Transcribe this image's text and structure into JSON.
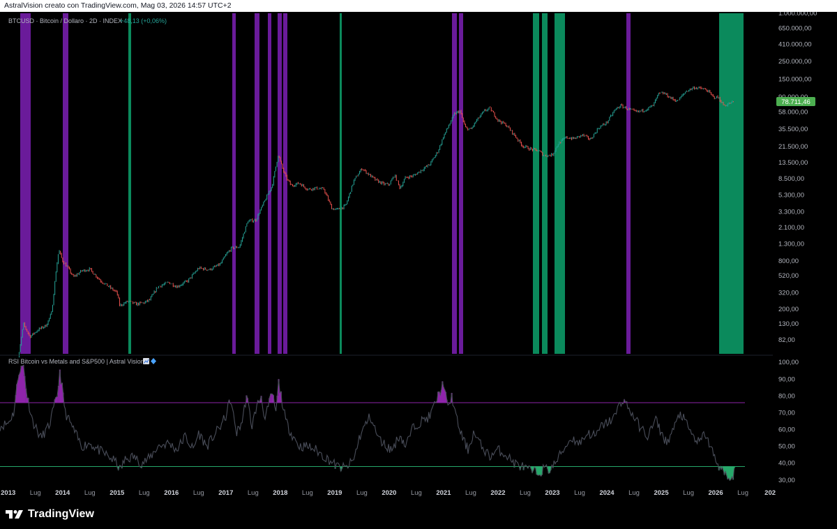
{
  "header": {
    "caption": "AstralVision creato con TradingView.com, Mag 03, 2026 14:57 UTC+2"
  },
  "price_pane": {
    "legend_symbol": "BTCUSD · Bitcoin / Dollaro · 2D · INDEX",
    "legend_change": "+48,13 (+0,06%)",
    "change_color": "#26a69a",
    "last_price_label": "78.711,46",
    "last_price_color": "#4caf50"
  },
  "indicator_pane": {
    "title": "RSI Bitcoin vs Metals and S&P500 | Astral Vision",
    "icons": [
      "chart-emoji-icon",
      "diamond-icon"
    ]
  },
  "footer": {
    "brand": "TradingView"
  },
  "colors": {
    "purple_band": "#6a1b9a",
    "green_band": "#0b8a5c",
    "rsi_line": "#4a4e5a",
    "upper_level": "#8e24aa",
    "lower_level": "#26a86a",
    "candle_up": "#26a69a",
    "candle_down": "#ef5350"
  },
  "chart_data": [
    {
      "type": "line",
      "name_in_legend": "BTCUSD · Bitcoin / Dollaro · 2D · INDEX",
      "scale": "log",
      "y_tick_labels": [
        "1.000.000,00",
        "650.000,00",
        "410.000,00",
        "250.000,00",
        "150.000,00",
        "90.000,00",
        "58.000,00",
        "35.500,00",
        "21.500,00",
        "13.500,00",
        "8.500,00",
        "5.300,00",
        "3.300,00",
        "2.100,00",
        "1.300,00",
        "800,00",
        "520,00",
        "320,00",
        "200,00",
        "130,00",
        "82,00"
      ],
      "y_tick_values": [
        1000000,
        650000,
        410000,
        250000,
        150000,
        90000,
        58000,
        35500,
        21500,
        13500,
        8500,
        5300,
        3300,
        2100,
        1300,
        800,
        520,
        320,
        200,
        130,
        82
      ],
      "ylim": [
        55,
        1000000
      ],
      "x_tick_labels": [
        "2013",
        "Lug",
        "2014",
        "Lug",
        "2015",
        "Lug",
        "2016",
        "Lug",
        "2017",
        "Lug",
        "2018",
        "Lug",
        "2019",
        "Lug",
        "2020",
        "Lug",
        "2021",
        "Lug",
        "2022",
        "Lug",
        "2023",
        "Lug",
        "2024",
        "Lug",
        "2025",
        "Lug",
        "2026",
        "Lug",
        "202"
      ],
      "x_tick_values": [
        2013.0,
        2013.5,
        2014.0,
        2014.5,
        2015.0,
        2015.5,
        2016.0,
        2016.5,
        2017.0,
        2017.5,
        2018.0,
        2018.5,
        2019.0,
        2019.5,
        2020.0,
        2020.5,
        2021.0,
        2021.5,
        2022.0,
        2022.5,
        2023.0,
        2023.5,
        2024.0,
        2024.5,
        2025.0,
        2025.5,
        2026.0,
        2026.5,
        2027.0
      ],
      "xlim": [
        2012.85,
        2027.05
      ],
      "x": [
        2013.12,
        2013.2,
        2013.28,
        2013.4,
        2013.55,
        2013.7,
        2013.8,
        2013.88,
        2013.93,
        2014.0,
        2014.1,
        2014.2,
        2014.35,
        2014.5,
        2014.7,
        2014.85,
        2015.0,
        2015.05,
        2015.2,
        2015.35,
        2015.5,
        2015.6,
        2015.75,
        2015.95,
        2016.1,
        2016.3,
        2016.5,
        2016.7,
        2016.9,
        2017.0,
        2017.1,
        2017.25,
        2017.4,
        2017.55,
        2017.7,
        2017.85,
        2017.96,
        2018.05,
        2018.1,
        2018.2,
        2018.35,
        2018.5,
        2018.65,
        2018.8,
        2018.95,
        2019.05,
        2019.2,
        2019.35,
        2019.5,
        2019.6,
        2019.75,
        2019.9,
        2020.0,
        2020.1,
        2020.2,
        2020.3,
        2020.45,
        2020.6,
        2020.75,
        2020.9,
        2021.0,
        2021.1,
        2021.2,
        2021.3,
        2021.4,
        2021.5,
        2021.6,
        2021.75,
        2021.85,
        2022.0,
        2022.15,
        2022.3,
        2022.45,
        2022.6,
        2022.75,
        2022.85,
        2023.0,
        2023.1,
        2023.25,
        2023.4,
        2023.55,
        2023.7,
        2023.85,
        2024.0,
        2024.15,
        2024.25,
        2024.4,
        2024.55,
        2024.7,
        2024.85,
        2024.95,
        2025.05,
        2025.2,
        2025.3,
        2025.45,
        2025.6,
        2025.75,
        2025.85,
        2025.95,
        2026.05,
        2026.15,
        2026.25,
        2026.34
      ],
      "y": [
        20,
        55,
        130,
        90,
        110,
        125,
        180,
        600,
        1100,
        800,
        650,
        500,
        600,
        630,
        450,
        380,
        320,
        220,
        250,
        230,
        240,
        260,
        380,
        430,
        380,
        450,
        650,
        620,
        730,
        950,
        1150,
        1200,
        2500,
        2600,
        4300,
        7000,
        17000,
        11000,
        9000,
        7000,
        7500,
        6300,
        6500,
        6300,
        3600,
        3500,
        3900,
        8000,
        11500,
        10000,
        8200,
        7300,
        7200,
        9500,
        6500,
        8800,
        9300,
        11000,
        13000,
        19000,
        29000,
        40000,
        55000,
        60000,
        37000,
        35000,
        45000,
        60000,
        65000,
        46000,
        40000,
        30000,
        22000,
        20000,
        19000,
        16500,
        17000,
        23000,
        28000,
        27000,
        30000,
        26500,
        37000,
        43000,
        62000,
        70000,
        63000,
        58000,
        62000,
        70000,
        98000,
        100000,
        85000,
        80000,
        105000,
        118000,
        114000,
        108000,
        90000,
        88000,
        70000,
        74000,
        78711.46
      ]
    },
    {
      "type": "area",
      "name_in_legend": "RSI Bitcoin vs Metals and S&P500 | Astral Vision",
      "y_tick_labels": [
        "100,00",
        "90,00",
        "80,00",
        "70,00",
        "60,00",
        "50,00",
        "40,00",
        "30,00"
      ],
      "y_tick_values": [
        100,
        90,
        80,
        70,
        60,
        50,
        40,
        30
      ],
      "ylim": [
        27,
        103
      ],
      "upper_level": 76,
      "lower_level": 38,
      "x": [
        2012.85,
        2013.0,
        2013.1,
        2013.2,
        2013.28,
        2013.35,
        2013.45,
        2013.6,
        2013.75,
        2013.9,
        2013.95,
        2014.05,
        2014.2,
        2014.35,
        2014.5,
        2014.65,
        2014.8,
        2015.0,
        2015.05,
        2015.15,
        2015.3,
        2015.45,
        2015.6,
        2015.75,
        2015.95,
        2016.1,
        2016.25,
        2016.4,
        2016.5,
        2016.65,
        2016.75,
        2016.9,
        2017.0,
        2017.08,
        2017.2,
        2017.3,
        2017.38,
        2017.48,
        2017.55,
        2017.65,
        2017.72,
        2017.8,
        2017.85,
        2017.92,
        2017.97,
        2018.1,
        2018.2,
        2018.35,
        2018.5,
        2018.65,
        2018.8,
        2018.9,
        2018.97,
        2019.05,
        2019.2,
        2019.35,
        2019.45,
        2019.55,
        2019.65,
        2019.8,
        2019.95,
        2020.05,
        2020.2,
        2020.3,
        2020.45,
        2020.6,
        2020.75,
        2020.9,
        2021.0,
        2021.08,
        2021.15,
        2021.25,
        2021.35,
        2021.45,
        2021.55,
        2021.7,
        2021.85,
        2022.0,
        2022.15,
        2022.3,
        2022.45,
        2022.55,
        2022.65,
        2022.75,
        2022.85,
        2022.95,
        2023.05,
        2023.2,
        2023.35,
        2023.5,
        2023.65,
        2023.8,
        2023.9,
        2024.05,
        2024.15,
        2024.22,
        2024.3,
        2024.45,
        2024.6,
        2024.75,
        2024.9,
        2025.0,
        2025.1,
        2025.25,
        2025.35,
        2025.45,
        2025.6,
        2025.7,
        2025.8,
        2025.9,
        2026.0,
        2026.1,
        2026.2,
        2026.3,
        2026.34
      ],
      "values": [
        62,
        64,
        70,
        95,
        98,
        80,
        65,
        55,
        62,
        80,
        95,
        70,
        60,
        50,
        52,
        48,
        45,
        40,
        36,
        42,
        44,
        40,
        43,
        50,
        52,
        48,
        56,
        48,
        58,
        50,
        55,
        62,
        68,
        78,
        58,
        65,
        80,
        62,
        72,
        80,
        66,
        76,
        82,
        70,
        88,
        65,
        58,
        50,
        50,
        48,
        44,
        42,
        40,
        38,
        37,
        42,
        55,
        62,
        68,
        55,
        50,
        48,
        57,
        50,
        62,
        65,
        68,
        80,
        88,
        72,
        80,
        65,
        55,
        48,
        58,
        50,
        44,
        48,
        45,
        40,
        38,
        36,
        35,
        34,
        37,
        36,
        40,
        48,
        55,
        52,
        58,
        56,
        62,
        65,
        68,
        74,
        78,
        70,
        62,
        56,
        66,
        58,
        52,
        62,
        70,
        64,
        55,
        52,
        58,
        50,
        42,
        36,
        32,
        29,
        37
      ]
    }
  ]
}
